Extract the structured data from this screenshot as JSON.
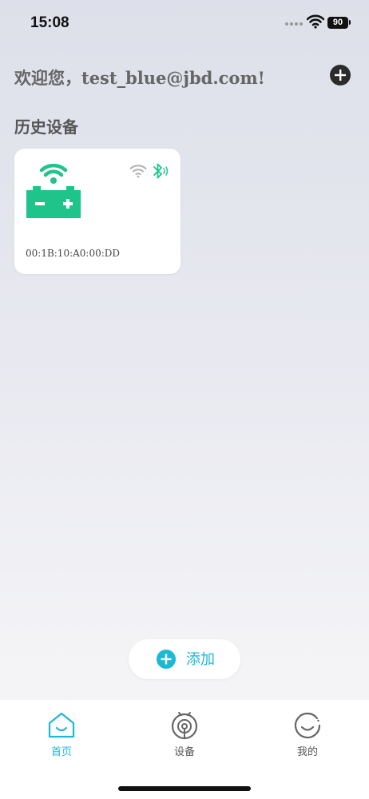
{
  "status_bar": {
    "time": "15:08",
    "battery_level": "90"
  },
  "header": {
    "welcome_text": "欢迎您，test_blue@jbd.com!"
  },
  "history": {
    "section_title": "历史设备",
    "devices": [
      {
        "mac": "00:1B:10:A0:00:DD",
        "icon": "battery-wifi-icon",
        "wifi_status_color": "#b0b0b0",
        "bluetooth_status_color": "#1fc48a"
      }
    ]
  },
  "add_button": {
    "label": "添加",
    "icon": "plus-circle-icon"
  },
  "bottom_nav": {
    "items": [
      {
        "label": "首页",
        "icon": "home-icon",
        "active": true
      },
      {
        "label": "设备",
        "icon": "device-icon",
        "active": false
      },
      {
        "label": "我的",
        "icon": "profile-icon",
        "active": false
      }
    ]
  },
  "colors": {
    "accent": "#1bb8d8",
    "device_green": "#1fc48a",
    "text_muted": "#666666"
  }
}
